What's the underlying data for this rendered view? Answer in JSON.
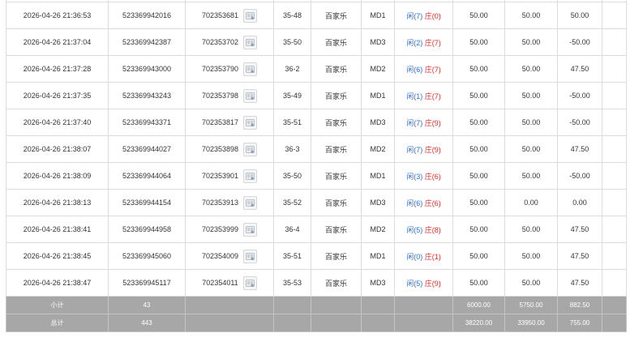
{
  "rows": [
    {
      "time": "2026-04-26 21:36:53",
      "order_no": "523369942016",
      "round_no": "702353681",
      "shoe": "35-48",
      "game": "百家乐",
      "table": "MD1",
      "xian": "闲(7)",
      "zhuang": "庄(0)",
      "bet": "50.00",
      "valid": "50.00",
      "win": "50.00",
      "win_negative": false
    },
    {
      "time": "2026-04-26 21:37:04",
      "order_no": "523369942387",
      "round_no": "702353702",
      "shoe": "35-50",
      "game": "百家乐",
      "table": "MD3",
      "xian": "闲(2)",
      "zhuang": "庄(7)",
      "bet": "50.00",
      "valid": "50.00",
      "win": "-50.00",
      "win_negative": true
    },
    {
      "time": "2026-04-26 21:37:28",
      "order_no": "523369943000",
      "round_no": "702353790",
      "shoe": "36-2",
      "game": "百家乐",
      "table": "MD2",
      "xian": "闲(6)",
      "zhuang": "庄(7)",
      "bet": "50.00",
      "valid": "50.00",
      "win": "47.50",
      "win_negative": false
    },
    {
      "time": "2026-04-26 21:37:35",
      "order_no": "523369943243",
      "round_no": "702353798",
      "shoe": "35-49",
      "game": "百家乐",
      "table": "MD1",
      "xian": "闲(1)",
      "zhuang": "庄(7)",
      "bet": "50.00",
      "valid": "50.00",
      "win": "-50.00",
      "win_negative": true
    },
    {
      "time": "2026-04-26 21:37:40",
      "order_no": "523369943371",
      "round_no": "702353817",
      "shoe": "35-51",
      "game": "百家乐",
      "table": "MD3",
      "xian": "闲(7)",
      "zhuang": "庄(9)",
      "bet": "50.00",
      "valid": "50.00",
      "win": "-50.00",
      "win_negative": true
    },
    {
      "time": "2026-04-26 21:38:07",
      "order_no": "523369944027",
      "round_no": "702353898",
      "shoe": "36-3",
      "game": "百家乐",
      "table": "MD2",
      "xian": "闲(7)",
      "zhuang": "庄(9)",
      "bet": "50.00",
      "valid": "50.00",
      "win": "47.50",
      "win_negative": false
    },
    {
      "time": "2026-04-26 21:38:09",
      "order_no": "523369944064",
      "round_no": "702353901",
      "shoe": "35-50",
      "game": "百家乐",
      "table": "MD1",
      "xian": "闲(3)",
      "zhuang": "庄(6)",
      "bet": "50.00",
      "valid": "50.00",
      "win": "-50.00",
      "win_negative": true
    },
    {
      "time": "2026-04-26 21:38:13",
      "order_no": "523369944154",
      "round_no": "702353913",
      "shoe": "35-52",
      "game": "百家乐",
      "table": "MD3",
      "xian": "闲(6)",
      "zhuang": "庄(6)",
      "bet": "50.00",
      "valid": "0.00",
      "win": "0.00",
      "win_negative": false
    },
    {
      "time": "2026-04-26 21:38:41",
      "order_no": "523369944958",
      "round_no": "702353999",
      "shoe": "36-4",
      "game": "百家乐",
      "table": "MD2",
      "xian": "闲(5)",
      "zhuang": "庄(8)",
      "bet": "50.00",
      "valid": "50.00",
      "win": "47.50",
      "win_negative": false
    },
    {
      "time": "2026-04-26 21:38:45",
      "order_no": "523369945060",
      "round_no": "702354009",
      "shoe": "35-51",
      "game": "百家乐",
      "table": "MD1",
      "xian": "闲(0)",
      "zhuang": "庄(1)",
      "bet": "50.00",
      "valid": "50.00",
      "win": "47.50",
      "win_negative": false
    },
    {
      "time": "2026-04-26 21:38:47",
      "order_no": "523369945117",
      "round_no": "702354011",
      "shoe": "35-53",
      "game": "百家乐",
      "table": "MD3",
      "xian": "闲(5)",
      "zhuang": "庄(9)",
      "bet": "50.00",
      "valid": "50.00",
      "win": "47.50",
      "win_negative": false
    }
  ],
  "subtotal": {
    "label": "小计",
    "count": "43",
    "bet": "6000.00",
    "valid": "5750.00",
    "win": "882.50"
  },
  "total": {
    "label": "总计",
    "count": "443",
    "bet": "38220.00",
    "valid": "33950.00",
    "win": "755.00"
  },
  "icons": {
    "round_thumbnail": "result-image-icon"
  },
  "colors": {
    "blue": "#2a6fd6",
    "red": "#e52b2b",
    "summary_bg": "#a7a7a7"
  }
}
